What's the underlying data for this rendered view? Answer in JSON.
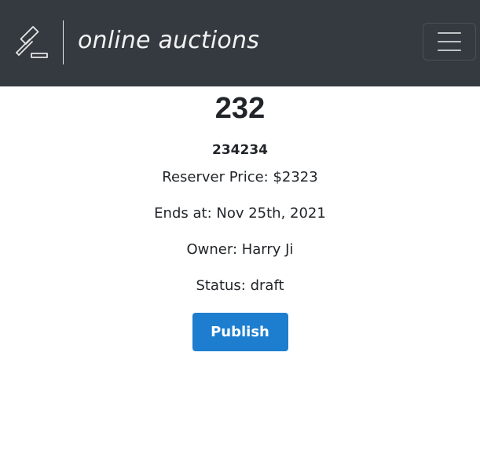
{
  "navbar": {
    "brand_text": "online auctions",
    "logo_icon": "gavel-icon",
    "menu_icon": "hamburger-menu-icon",
    "background": "#343a40"
  },
  "auction": {
    "title": "232",
    "subtitle": "234234",
    "reserve_price": "Reserver Price: $2323",
    "ends_at": "Ends at: Nov 25th, 2021",
    "owner": "Owner: Harry Ji",
    "status": "Status: draft"
  },
  "actions": {
    "publish_label": "Publish",
    "publish_color": "#1d7ecf"
  }
}
